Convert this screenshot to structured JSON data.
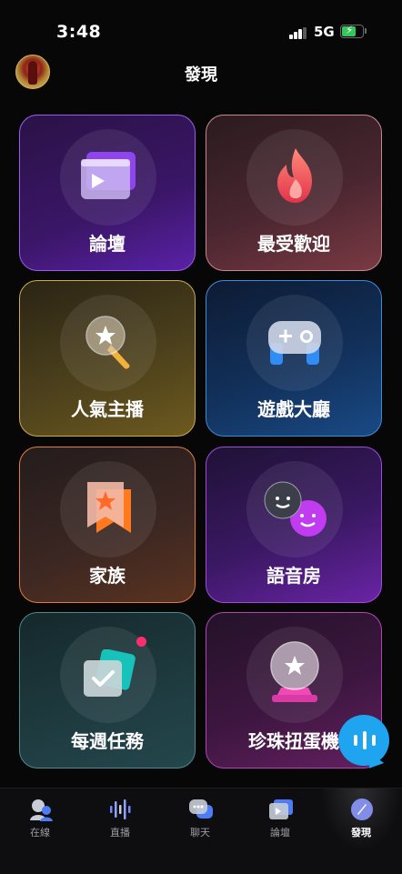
{
  "status_bar": {
    "time": "3:48",
    "network": "5G"
  },
  "header": {
    "title": "發現"
  },
  "tiles": [
    {
      "label": "論壇",
      "icon": "video-forum-icon"
    },
    {
      "label": "最受歡迎",
      "icon": "flame-icon"
    },
    {
      "label": "人氣主播",
      "icon": "star-badge-icon"
    },
    {
      "label": "遊戲大廳",
      "icon": "gamepad-icon"
    },
    {
      "label": "家族",
      "icon": "bookmark-star-icon"
    },
    {
      "label": "語音房",
      "icon": "smiley-faces-icon"
    },
    {
      "label": "每週任務",
      "icon": "checklist-card-icon"
    },
    {
      "label": "珍珠扭蛋機",
      "icon": "crystal-ball-icon"
    }
  ],
  "tabbar": {
    "items": [
      {
        "label": "在線",
        "icon": "users-icon"
      },
      {
        "label": "直播",
        "icon": "waveform-icon"
      },
      {
        "label": "聊天",
        "icon": "chat-bubble-icon"
      },
      {
        "label": "論壇",
        "icon": "video-card-icon"
      },
      {
        "label": "發現",
        "icon": "compass-icon",
        "active": true
      }
    ]
  },
  "colors": {
    "fab": "#1fa4f0",
    "accent_purple": "#9a5cf0",
    "notification_dot": "#ff2d6f"
  }
}
